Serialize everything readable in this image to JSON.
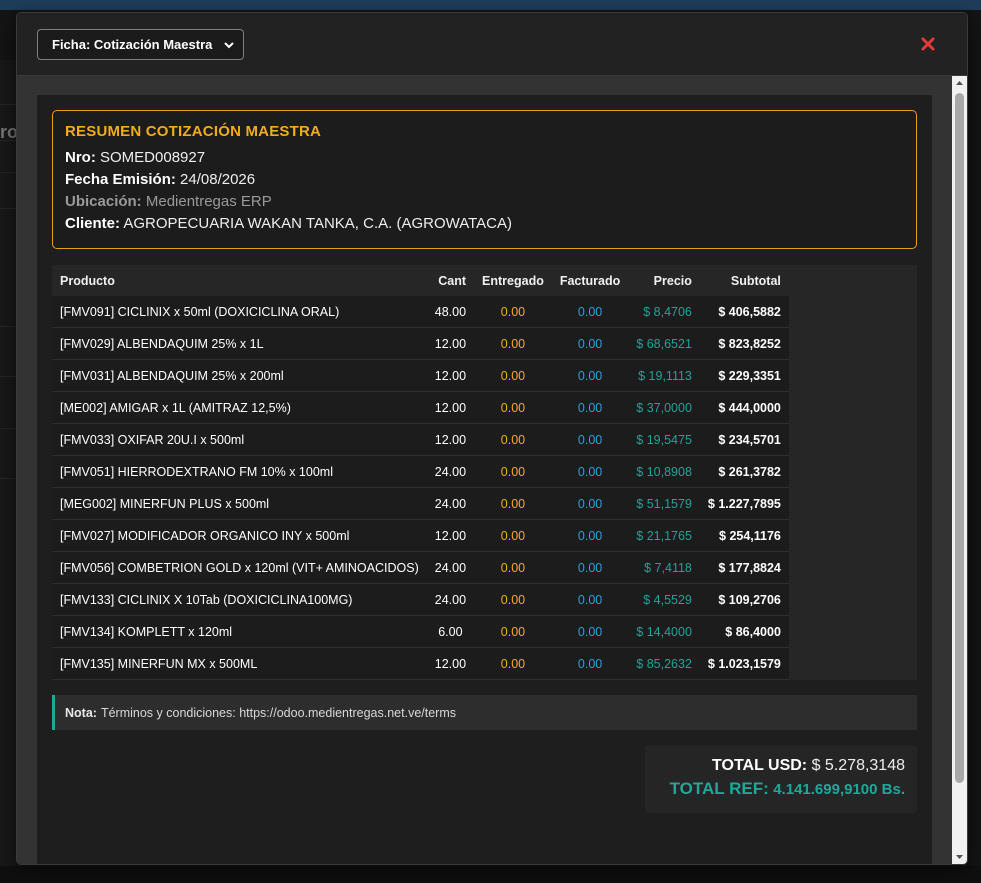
{
  "header": {
    "sheet_select_label": "Ficha: Cotización Maestra"
  },
  "summary": {
    "title": "RESUMEN COTIZACIÓN MAESTRA",
    "nro_label": "Nro:",
    "nro_value": "SOMED008927",
    "fecha_label": "Fecha Emisión:",
    "fecha_value": "24/08/2026",
    "ubicacion_label": "Ubicación:",
    "ubicacion_value": "Medientregas ERP",
    "cliente_label": "Cliente:",
    "cliente_value": "AGROPECUARIA WAKAN TANKA, C.A. (AGROWATACA)"
  },
  "table": {
    "columns": [
      "Producto",
      "Cant",
      "Entregado",
      "Facturado",
      "Precio",
      "Subtotal"
    ],
    "rows": [
      {
        "product": "[FMV091] CICLINIX x 50ml (DOXICICLINA ORAL)",
        "cant": "48.00",
        "entregado": "0.00",
        "facturado": "0.00",
        "precio": "$ 8,4706",
        "subtotal": "$ 406,5882"
      },
      {
        "product": "[FMV029] ALBENDAQUIM 25% x 1L",
        "cant": "12.00",
        "entregado": "0.00",
        "facturado": "0.00",
        "precio": "$ 68,6521",
        "subtotal": "$ 823,8252"
      },
      {
        "product": "[FMV031] ALBENDAQUIM 25% x 200ml",
        "cant": "12.00",
        "entregado": "0.00",
        "facturado": "0.00",
        "precio": "$ 19,1113",
        "subtotal": "$ 229,3351"
      },
      {
        "product": "[ME002] AMIGAR x 1L (AMITRAZ 12,5%)",
        "cant": "12.00",
        "entregado": "0.00",
        "facturado": "0.00",
        "precio": "$ 37,0000",
        "subtotal": "$ 444,0000"
      },
      {
        "product": "[FMV033] OXIFAR 20U.I x 500ml",
        "cant": "12.00",
        "entregado": "0.00",
        "facturado": "0.00",
        "precio": "$ 19,5475",
        "subtotal": "$ 234,5701"
      },
      {
        "product": "[FMV051] HIERRODEXTRANO FM 10% x 100ml",
        "cant": "24.00",
        "entregado": "0.00",
        "facturado": "0.00",
        "precio": "$ 10,8908",
        "subtotal": "$ 261,3782"
      },
      {
        "product": "[MEG002] MINERFUN PLUS x 500ml",
        "cant": "24.00",
        "entregado": "0.00",
        "facturado": "0.00",
        "precio": "$ 51,1579",
        "subtotal": "$ 1.227,7895"
      },
      {
        "product": "[FMV027] MODIFICADOR ORGANICO INY x 500ml",
        "cant": "12.00",
        "entregado": "0.00",
        "facturado": "0.00",
        "precio": "$ 21,1765",
        "subtotal": "$ 254,1176"
      },
      {
        "product": "[FMV056] COMBETRION GOLD x 120ml (VIT+ AMINOACIDOS)",
        "cant": "24.00",
        "entregado": "0.00",
        "facturado": "0.00",
        "precio": "$ 7,4118",
        "subtotal": "$ 177,8824"
      },
      {
        "product": "[FMV133] CICLINIX X 10Tab (DOXICICLINA100MG)",
        "cant": "24.00",
        "entregado": "0.00",
        "facturado": "0.00",
        "precio": "$ 4,5529",
        "subtotal": "$ 109,2706"
      },
      {
        "product": "[FMV134] KOMPLETT x 120ml",
        "cant": "6.00",
        "entregado": "0.00",
        "facturado": "0.00",
        "precio": "$ 14,4000",
        "subtotal": "$ 86,4000"
      },
      {
        "product": "[FMV135] MINERFUN MX x 500ML",
        "cant": "12.00",
        "entregado": "0.00",
        "facturado": "0.00",
        "precio": "$ 85,2632",
        "subtotal": "$ 1.023,1579"
      }
    ]
  },
  "note": {
    "label": "Nota:",
    "text": "Términos y condiciones: https://odoo.medientregas.net.ve/terms"
  },
  "totals": {
    "usd_label": "TOTAL USD:",
    "usd_value": "$ 5.278,3148",
    "ref_label": "TOTAL REF:",
    "ref_value": "4.141.699,9100 Bs."
  },
  "background": {
    "side_fragment": "ro"
  },
  "icons": {
    "close": "close-icon",
    "dropdown": "chevron-down-icon"
  },
  "colors": {
    "accent_orange": "#f2ac1a",
    "accent_teal": "#1fa89a",
    "accent_blue": "#2e9fd9",
    "close_red": "#e53935"
  }
}
